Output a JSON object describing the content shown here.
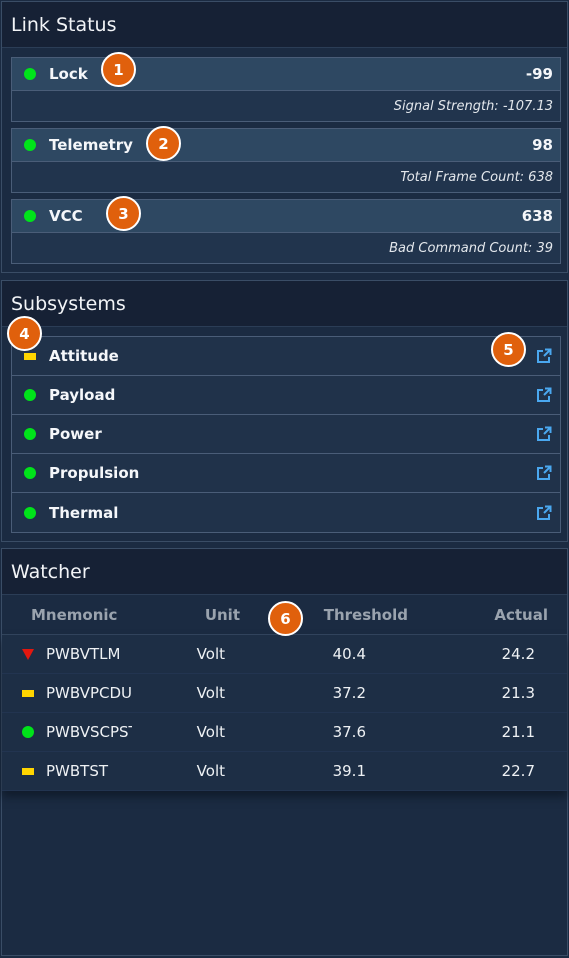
{
  "link_status": {
    "title": "Link Status",
    "items": [
      {
        "label": "Lock",
        "value": "-99",
        "status": "ok",
        "detail": "Signal Strength:  -107.13"
      },
      {
        "label": "Telemetry",
        "value": "98",
        "status": "ok",
        "detail": "Total Frame Count:  638"
      },
      {
        "label": "VCC",
        "value": "638",
        "status": "ok",
        "detail": "Bad Command Count:  39"
      }
    ]
  },
  "subsystems": {
    "title": "Subsystems",
    "items": [
      {
        "label": "Attitude",
        "status": "caution",
        "icon": "external-link-icon"
      },
      {
        "label": "Payload",
        "status": "ok",
        "icon": "external-link-icon"
      },
      {
        "label": "Power",
        "status": "ok",
        "icon": "external-link-icon"
      },
      {
        "label": "Propulsion",
        "status": "ok",
        "icon": "external-link-icon"
      },
      {
        "label": "Thermal",
        "status": "ok",
        "icon": "external-link-icon"
      }
    ]
  },
  "watcher": {
    "title": "Watcher",
    "columns": [
      "Mnemonic",
      "Unit",
      "Threshold",
      "Actual"
    ],
    "rows": [
      {
        "status": "critical",
        "mnemonic": "PWBVTLM",
        "unit": "Volt",
        "threshold": "40.4",
        "actual": "24.2"
      },
      {
        "status": "caution",
        "mnemonic": "PWBVPCDU",
        "unit": "Volt",
        "threshold": "37.2",
        "actual": "21.3"
      },
      {
        "status": "ok",
        "mnemonic": "PWBVSCPST",
        "unit": "Volt",
        "threshold": "37.6",
        "actual": "21.1"
      },
      {
        "status": "caution",
        "mnemonic": "PWBTST",
        "unit": "Volt",
        "threshold": "39.1",
        "actual": "22.7"
      }
    ]
  },
  "badges": [
    "1",
    "2",
    "3",
    "4",
    "5",
    "6"
  ],
  "colors": {
    "ok": "#00e31a",
    "caution": "#ffd500",
    "critical": "#e3170f",
    "badge": "#e0600c",
    "link_icon": "#4aa8f0"
  }
}
